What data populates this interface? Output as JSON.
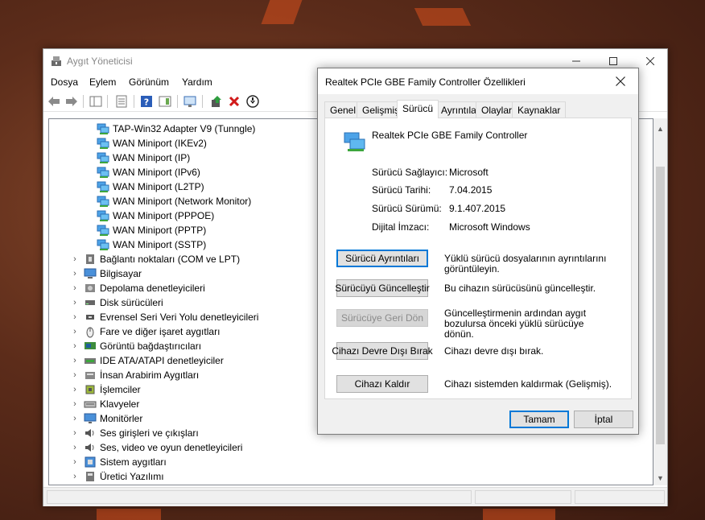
{
  "device_manager": {
    "title": "Aygıt Yöneticisi",
    "menu": [
      "Dosya",
      "Eylem",
      "Görünüm",
      "Yardım"
    ],
    "tree_items": [
      {
        "label": "TAP-Win32 Adapter V9 (Tunngle)",
        "icon": "network-adapter-icon",
        "child": true
      },
      {
        "label": "WAN Miniport (IKEv2)",
        "icon": "network-adapter-icon",
        "child": true
      },
      {
        "label": "WAN Miniport (IP)",
        "icon": "network-adapter-icon",
        "child": true
      },
      {
        "label": "WAN Miniport (IPv6)",
        "icon": "network-adapter-icon",
        "child": true
      },
      {
        "label": "WAN Miniport (L2TP)",
        "icon": "network-adapter-icon",
        "child": true
      },
      {
        "label": "WAN Miniport (Network Monitor)",
        "icon": "network-adapter-icon",
        "child": true
      },
      {
        "label": "WAN Miniport (PPPOE)",
        "icon": "network-adapter-icon",
        "child": true
      },
      {
        "label": "WAN Miniport (PPTP)",
        "icon": "network-adapter-icon",
        "child": true
      },
      {
        "label": "WAN Miniport (SSTP)",
        "icon": "network-adapter-icon",
        "child": true
      },
      {
        "label": "Bağlantı noktaları (COM ve LPT)",
        "icon": "port-icon",
        "child": false
      },
      {
        "label": "Bilgisayar",
        "icon": "computer-icon",
        "child": false
      },
      {
        "label": "Depolama denetleyicileri",
        "icon": "storage-controller-icon",
        "child": false
      },
      {
        "label": "Disk sürücüleri",
        "icon": "disk-drive-icon",
        "child": false
      },
      {
        "label": "Evrensel Seri Veri Yolu denetleyicileri",
        "icon": "usb-icon",
        "child": false
      },
      {
        "label": "Fare ve diğer işaret aygıtları",
        "icon": "mouse-icon",
        "child": false
      },
      {
        "label": "Görüntü bağdaştırıcıları",
        "icon": "display-adapter-icon",
        "child": false
      },
      {
        "label": "IDE ATA/ATAPI denetleyiciler",
        "icon": "ide-controller-icon",
        "child": false
      },
      {
        "label": "İnsan Arabirim Aygıtları",
        "icon": "hid-icon",
        "child": false
      },
      {
        "label": "İşlemciler",
        "icon": "processor-icon",
        "child": false
      },
      {
        "label": "Klavyeler",
        "icon": "keyboard-icon",
        "child": false
      },
      {
        "label": "Monitörler",
        "icon": "monitor-icon",
        "child": false
      },
      {
        "label": "Ses girişleri ve çıkışları",
        "icon": "speaker-icon",
        "child": false
      },
      {
        "label": "Ses, video ve oyun denetleyicileri",
        "icon": "speaker-icon",
        "child": false
      },
      {
        "label": "Sistem aygıtları",
        "icon": "system-device-icon",
        "child": false
      },
      {
        "label": "Üretici Yazılımı",
        "icon": "firmware-icon",
        "child": false
      }
    ]
  },
  "dialog": {
    "title": "Realtek PCIe GBE Family Controller Özellikleri",
    "tabs": [
      "Genel",
      "Gelişmiş",
      "Sürücü",
      "Ayrıntılar",
      "Olaylar",
      "Kaynaklar"
    ],
    "active_tab": "Sürücü",
    "device_name": "Realtek PCIe GBE Family Controller",
    "properties": [
      {
        "label": "Sürücü Sağlayıcı:",
        "value": "Microsoft"
      },
      {
        "label": "Sürücü Tarihi:",
        "value": "7.04.2015"
      },
      {
        "label": "Sürücü Sürümü:",
        "value": "9.1.407.2015"
      },
      {
        "label": "Dijital İmzacı:",
        "value": "Microsoft Windows"
      }
    ],
    "actions": [
      {
        "button": "Sürücü Ayrıntıları",
        "desc": "Yüklü sürücü dosyalarının ayrıntılarını görüntüleyin.",
        "state": "primary"
      },
      {
        "button": "Sürücüyü Güncelleştir",
        "desc": "Bu cihazın sürücüsünü güncelleştir.",
        "state": "normal"
      },
      {
        "button": "Sürücüye Geri Dön",
        "desc": "Güncelleştirmenin ardından aygıt bozulursa önceki yüklü sürücüye dönün.",
        "state": "disabled"
      },
      {
        "button": "Cihazı Devre Dışı Bırak",
        "desc": "Cihazı devre dışı bırak.",
        "state": "normal"
      },
      {
        "button": "Cihazı Kaldır",
        "desc": "Cihazı sistemden kaldırmak (Gelişmiş).",
        "state": "normal"
      }
    ],
    "ok_label": "Tamam",
    "cancel_label": "İptal"
  },
  "colors": {
    "accent": "#0078d7",
    "dialog_bg": "#f0f0f0",
    "disabled_text": "#8a8a8a"
  }
}
